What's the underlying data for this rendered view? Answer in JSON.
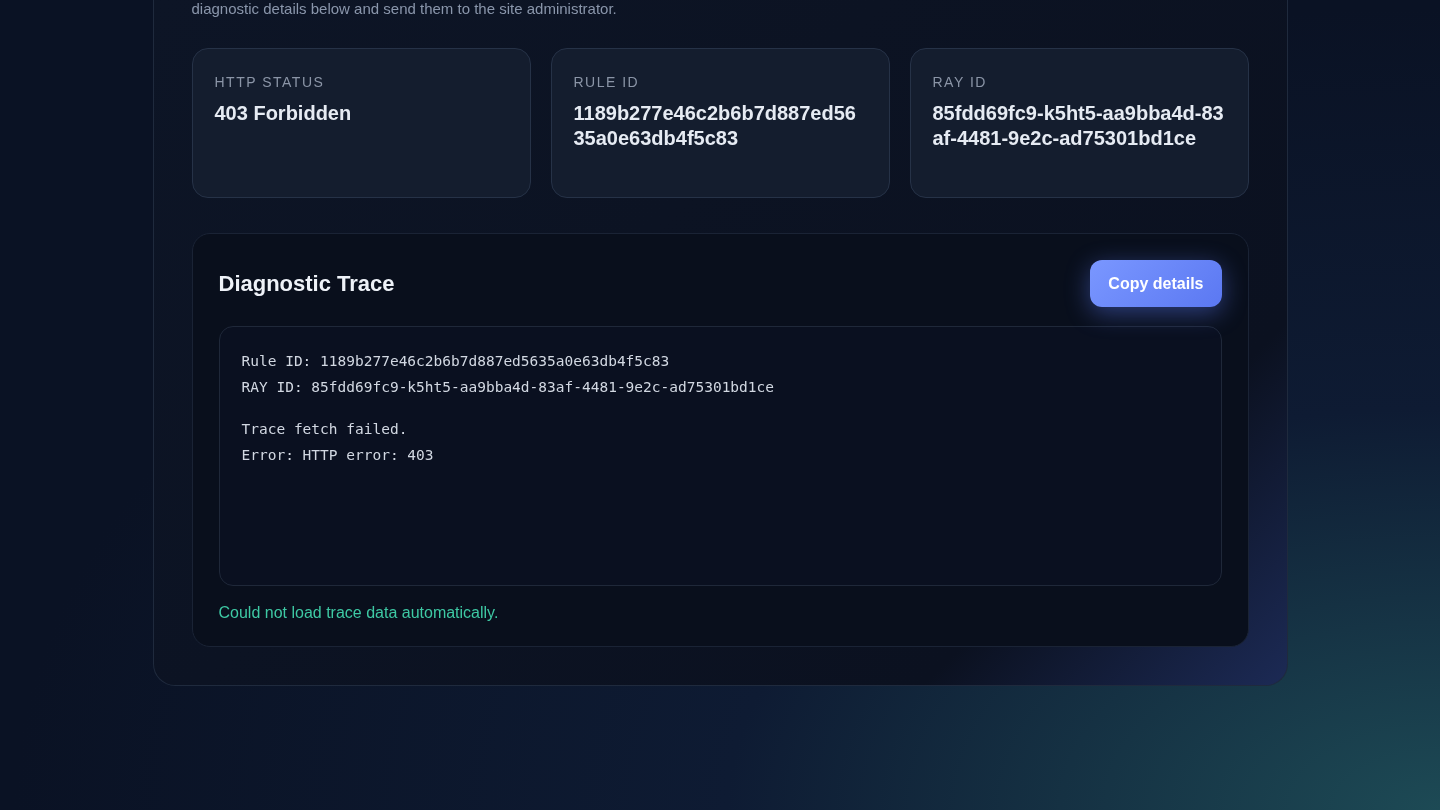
{
  "intro": "diagnostic details below and send them to the site administrator.",
  "stats": [
    {
      "label": "HTTP STATUS",
      "value": "403 Forbidden"
    },
    {
      "label": "RULE ID",
      "value": "1189b277e46c2b6b7d887ed5635a0e63db4f5c83"
    },
    {
      "label": "RAY ID",
      "value": "85fdd69fc9-k5ht5-aa9bba4d-83af-4481-9e2c-ad75301bd1ce"
    }
  ],
  "trace": {
    "title": "Diagnostic Trace",
    "button": "Copy details",
    "blocks": [
      [
        "Rule ID: 1189b277e46c2b6b7d887ed5635a0e63db4f5c83",
        "RAY ID: 85fdd69fc9-k5ht5-aa9bba4d-83af-4481-9e2c-ad75301bd1ce"
      ],
      [
        "Trace fetch failed.",
        "Error: HTTP error: 403"
      ]
    ],
    "status": "Could not load trace data automatically."
  }
}
